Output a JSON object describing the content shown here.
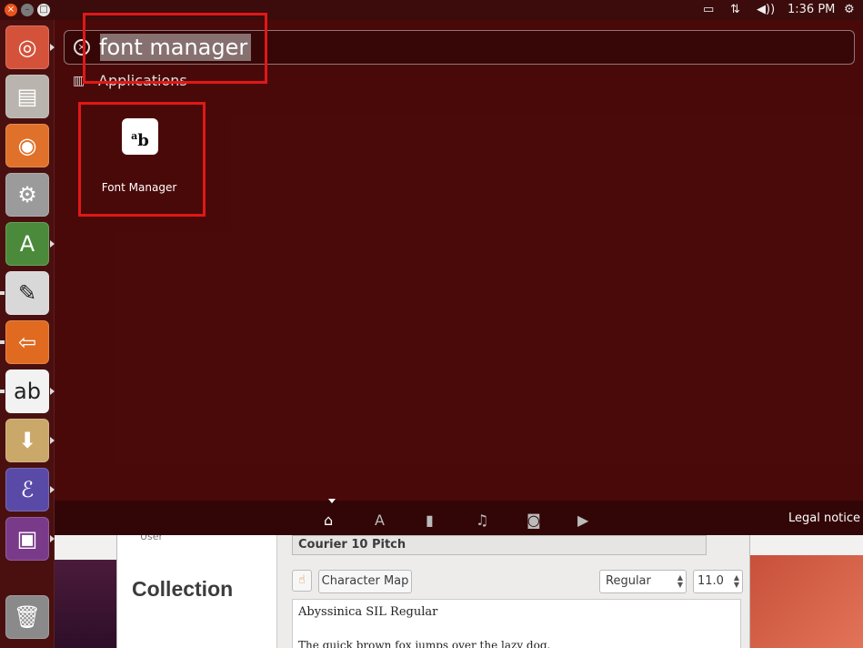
{
  "panel": {
    "battery_icon": "battery-icon",
    "network_icon": "network-icon",
    "volume_icon": "volume-icon",
    "clock": "1:36 PM",
    "settings_icon": "gear-icon"
  },
  "window_controls": {
    "close": "×",
    "minimize": "–",
    "maximize": "□"
  },
  "launcher": {
    "items": [
      {
        "name": "dash-home",
        "icon": "ubuntu-logo-icon",
        "glyph": "◎",
        "bg": "#d4523a"
      },
      {
        "name": "files",
        "icon": "file-cabinet-icon",
        "glyph": "▤",
        "bg": "#b9b4ae"
      },
      {
        "name": "firefox",
        "icon": "firefox-icon",
        "glyph": "◉",
        "bg": "#e0712a"
      },
      {
        "name": "system-settings",
        "icon": "settings-wrench-icon",
        "glyph": "⚙",
        "bg": "#9b9b9b"
      },
      {
        "name": "update-manager",
        "icon": "update-icon",
        "glyph": "A",
        "bg": "#4a8a3a"
      },
      {
        "name": "text-editor",
        "icon": "text-editor-icon",
        "glyph": "✎",
        "bg": "#d8d8d8"
      },
      {
        "name": "backups",
        "icon": "arrow-left-icon",
        "glyph": "⇦",
        "bg": "#e06a20"
      },
      {
        "name": "font-manager",
        "icon": "font-manager-icon",
        "glyph": "ab",
        "bg": "#f2f2f2"
      },
      {
        "name": "downloads",
        "icon": "archive-download-icon",
        "glyph": "⬇",
        "bg": "#c9a86a"
      },
      {
        "name": "emacs",
        "icon": "emacs-icon",
        "glyph": "ℰ",
        "bg": "#5a4aa8"
      },
      {
        "name": "system-monitor",
        "icon": "monitor-icon",
        "glyph": "▣",
        "bg": "#7a3a8a"
      },
      {
        "name": "trash",
        "icon": "trash-icon",
        "glyph": "🗑",
        "bg": "#8a8a8a"
      }
    ]
  },
  "search": {
    "query": "font manager"
  },
  "category": {
    "label": "Applications"
  },
  "results": [
    {
      "label": "Font Manager",
      "icon": "font-manager-icon"
    }
  ],
  "lenses": [
    {
      "name": "home",
      "icon": "home-icon",
      "glyph": "⌂"
    },
    {
      "name": "applications",
      "icon": "applications-icon",
      "glyph": "A"
    },
    {
      "name": "files",
      "icon": "file-icon",
      "glyph": "▮"
    },
    {
      "name": "music",
      "icon": "music-icon",
      "glyph": "♫"
    },
    {
      "name": "photos",
      "icon": "camera-icon",
      "glyph": "◙"
    },
    {
      "name": "video",
      "icon": "video-icon",
      "glyph": "▶"
    }
  ],
  "legal_notice": "Legal notice",
  "background_window": {
    "user_label": "User",
    "collection_heading": "Collection",
    "selected_font": "Courier 10 Pitch",
    "character_map": "Character Map",
    "style": "Regular",
    "size": "11.0",
    "preview_font": "Abyssinica SIL Regular",
    "preview_text": "The quick brown fox jumps over the lazy dog."
  },
  "colors": {
    "highlight": "#e01818",
    "dash_bg": "#4b0a0a",
    "accent": "#e9531e"
  }
}
